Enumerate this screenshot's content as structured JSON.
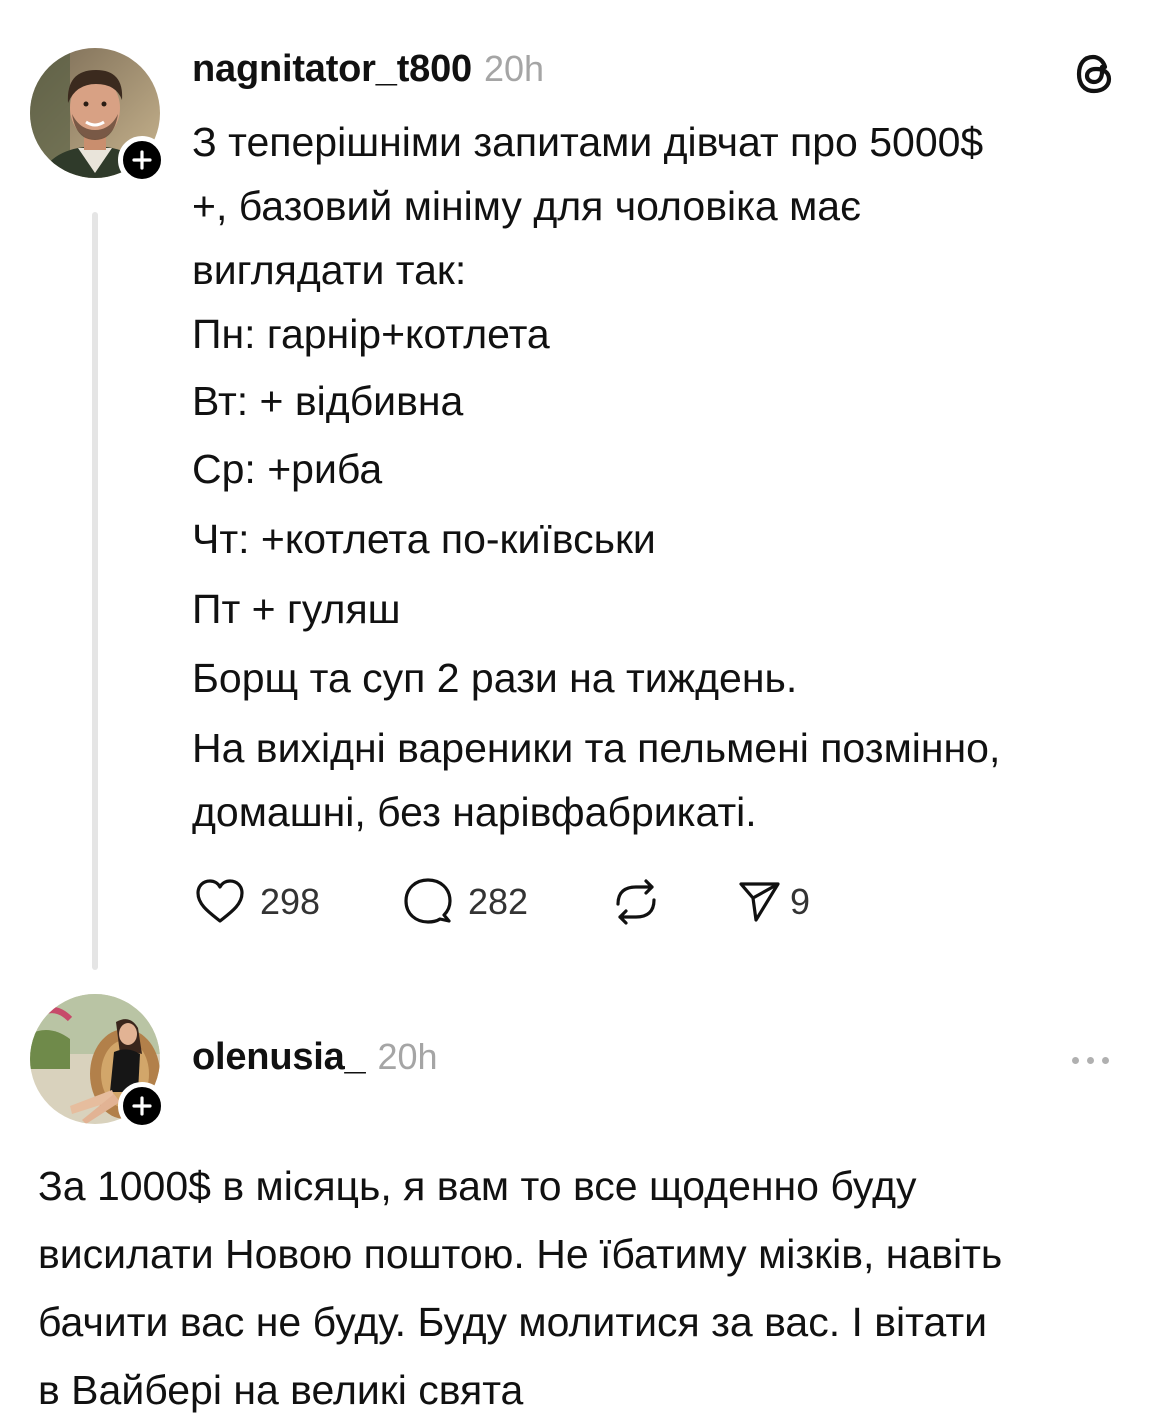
{
  "post": {
    "username": "nagnitator_t800",
    "time": "20h",
    "lines": [
      "З теперішніми запитами дівчат про 5000$",
      "+, базовий мініму для чоловіка має",
      "виглядати так:",
      "Пн: гарнір+котлета",
      "Вт: + відбивна",
      "Ср: +риба",
      "Чт: +котлета по-київськи",
      "Пт + гуляш",
      "Борщ та суп 2 рази на тиждень.",
      "На вихідні вареники та пельмені позмінно,",
      "домашні, без нарівфабрикаті."
    ],
    "likes": "298",
    "comments": "282",
    "shares": "9"
  },
  "reply": {
    "username": "olenusia_",
    "time": "20h",
    "lines": [
      "За 1000$ в місяць, я вам то все щоденно буду",
      "висилати Новою поштою. Не їбатиму мізків, навіть",
      "бачити вас не буду. Буду молитися за вас. І вітати",
      "в Вайбері на великі свята"
    ]
  },
  "icons": {
    "brand": "threads-icon",
    "like": "heart-icon",
    "comment": "comment-icon",
    "repost": "repost-icon",
    "share": "send-icon",
    "more": "more-icon",
    "follow": "plus-icon"
  }
}
